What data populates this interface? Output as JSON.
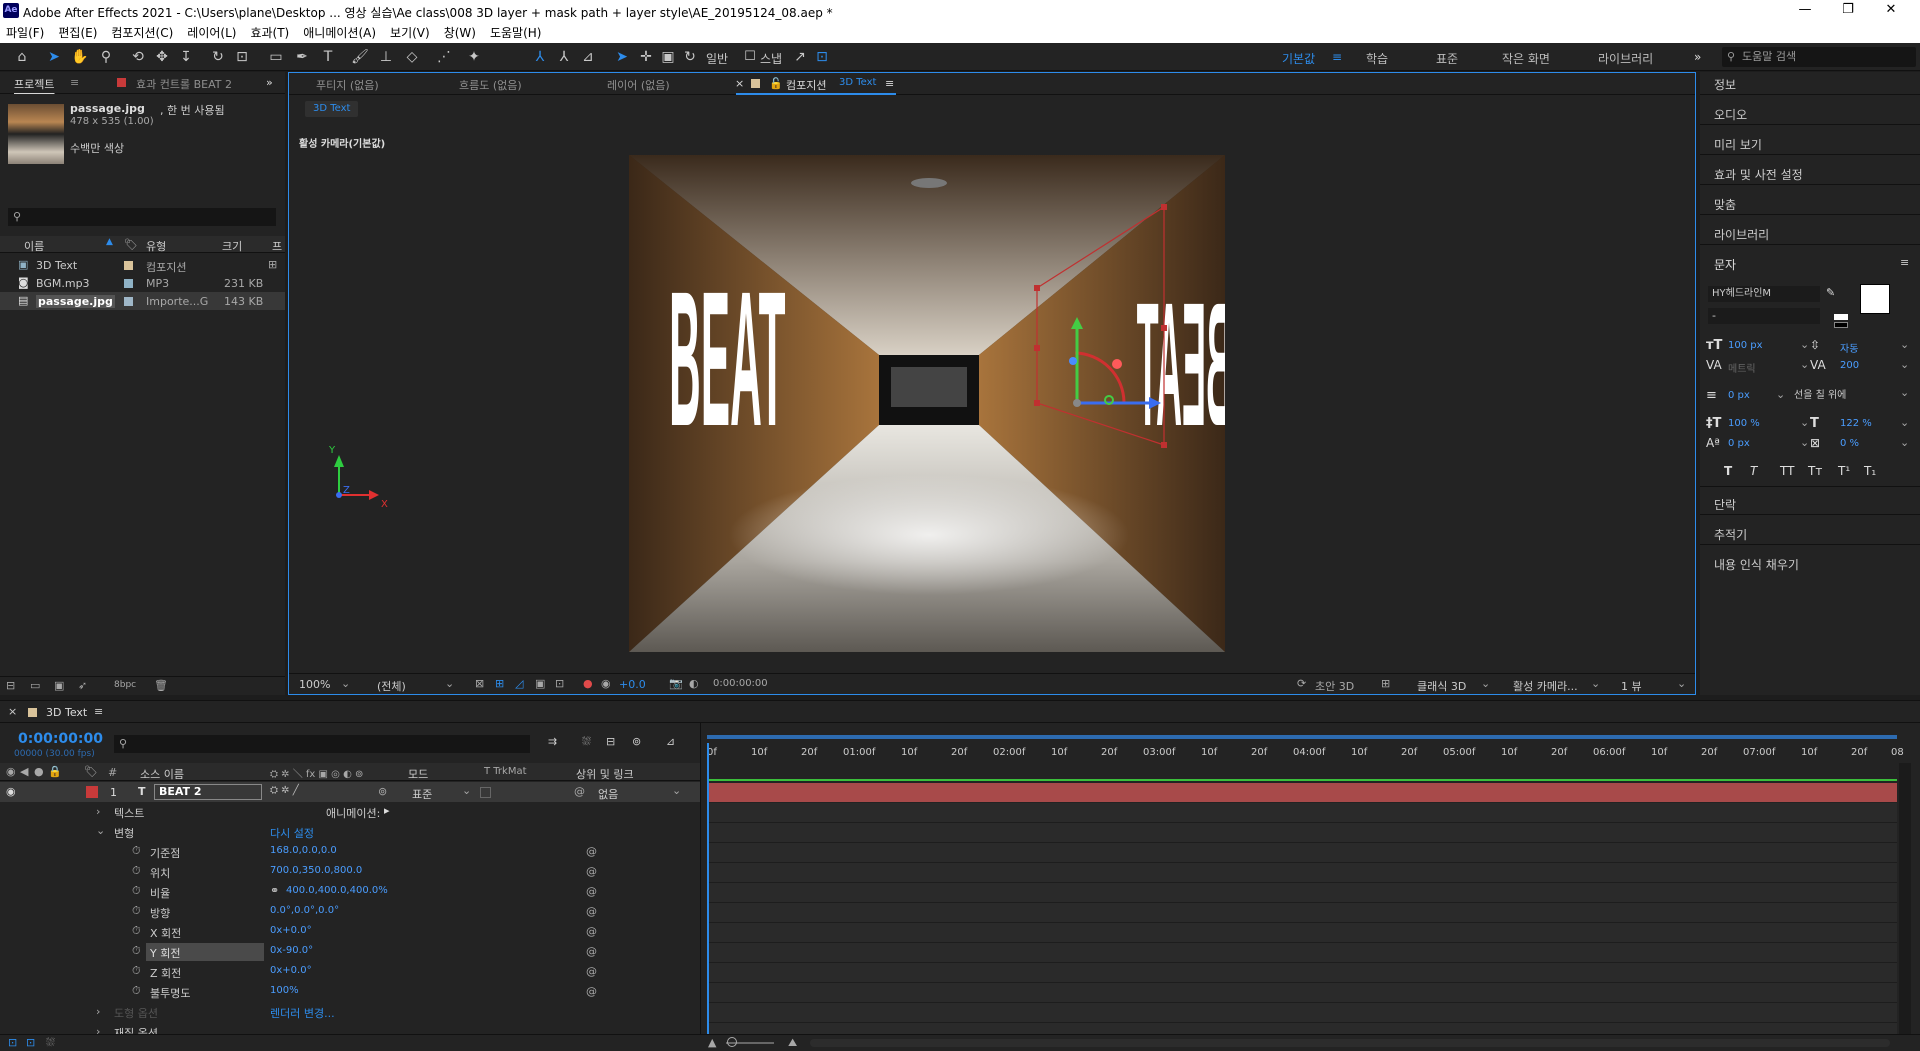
{
  "window": {
    "app_icon": "Ae",
    "title": "Adobe After Effects 2021 - C:\\Users\\plane\\Desktop ... 영상 실습\\Ae class\\008 3D layer + mask path + layer style\\AE_20195124_08.aep *",
    "minimize": "—",
    "maximize": "❐",
    "close": "✕"
  },
  "menu": [
    "파일(F)",
    "편집(E)",
    "컴포지션(C)",
    "레이어(L)",
    "효과(T)",
    "애니메이션(A)",
    "보기(V)",
    "창(W)",
    "도움말(H)"
  ],
  "toolbar": {
    "snap_label": "스냅",
    "align_label": "일반",
    "workspaces": [
      "기본값",
      "학습",
      "표준",
      "작은 화면",
      "라이브러리"
    ],
    "active_workspace": "기본값",
    "search_placeholder": "도움말 검색",
    "more": "»"
  },
  "project": {
    "tab_project": "프로젝트",
    "tab_effects": "효과 컨트롤 BEAT 2",
    "item_name": "passage.jpg",
    "item_usage": ", 한 번 사용됨",
    "item_dims": "478 x 535 (1.00)",
    "item_color": "수백만 색상",
    "search_placeholder": "",
    "columns": [
      "이름",
      "유형",
      "크기",
      "프"
    ],
    "items": [
      {
        "name": "3D Text",
        "type": "컴포지션",
        "size": "",
        "color": "#d9c39a"
      },
      {
        "name": "BGM.mp3",
        "type": "MP3",
        "size": "231 KB",
        "color": "#8fb2c6"
      },
      {
        "name": "passage.jpg",
        "type": "Importe...G",
        "size": "143 KB",
        "color": "#9fb7c8"
      }
    ],
    "bpc": "8bpc"
  },
  "viewer": {
    "tabs": [
      "푸티지 (없음)",
      "흐름도 (없음)",
      "레이어 (없음)",
      "컴포지션"
    ],
    "active_comp": "3D Text",
    "breadcrumb": "3D Text",
    "camera_label": "활성 카메라(기본값)",
    "scene_text_left": "BEAT",
    "scene_text_right": "BEAT",
    "zoom": "100%",
    "resolution": "(전체)",
    "exposure": "+0.0",
    "timecode": "0:00:00:00",
    "draft": "초안 3D",
    "renderer": "클래식 3D",
    "camera": "활성 카메라...",
    "views": "1 뷰",
    "axis_x": "X",
    "axis_y": "Y",
    "axis_z": "Z"
  },
  "right_panel": {
    "sections": [
      "정보",
      "오디오",
      "미리 보기",
      "효과 및 사전 설정",
      "맞춤",
      "라이브러리"
    ],
    "char_title": "문자",
    "font": "HY헤드라인M",
    "font_style": "-",
    "size": "100 px",
    "leading": "자동",
    "tracking_label": "메트릭",
    "tracking": "200",
    "stroke": "0 px",
    "stroke_mode": "선을 칠 위에",
    "vscale": "100 %",
    "hscale": "122 %",
    "baseline": "0 px",
    "tsume": "0 %",
    "style_buttons": [
      "T",
      "T",
      "TT",
      "Tт",
      "T¹",
      "T₁"
    ],
    "after": [
      "단락",
      "추적기",
      "내용 인식 채우기"
    ]
  },
  "timeline": {
    "tab": "3D Text",
    "timecode": "0:00:00:00",
    "fps": "00000 (30.00 fps)",
    "columns": {
      "num": "#",
      "source": "소스 이름",
      "mode": "모드",
      "trkmat": "T  TrkMat",
      "parent": "상위 및 링크"
    },
    "layer": {
      "num": "1",
      "type": "T",
      "name": "BEAT 2",
      "mode": "표준",
      "parent": "없음",
      "color": "#c83a3a"
    },
    "text_group": "텍스트",
    "animate": "애니메이션:",
    "transform_group": "변형",
    "reset": "다시 설정",
    "props": [
      {
        "name": "기준점",
        "value": "168.0,0.0,0.0"
      },
      {
        "name": "위치",
        "value": "700.0,350.0,800.0"
      },
      {
        "name": "비율",
        "value": "400.0,400.0,400.0%"
      },
      {
        "name": "방향",
        "value": "0.0°,0.0°,0.0°"
      },
      {
        "name": "X 회전",
        "value": "0x+0.0°"
      },
      {
        "name": "Y 회전",
        "value": "0x-90.0°"
      },
      {
        "name": "Z 회전",
        "value": "0x+0.0°"
      },
      {
        "name": "불투명도",
        "value": "100%"
      }
    ],
    "geometry_group": "도형 옵션",
    "geometry_value": "렌더러 변경...",
    "material_group": "재질 옵션",
    "ruler": [
      "0f",
      "10f",
      "20f",
      "01:00f",
      "10f",
      "20f",
      "02:00f",
      "10f",
      "20f",
      "03:00f",
      "10f",
      "20f",
      "04:00f",
      "10f",
      "20f",
      "05:00f",
      "10f",
      "20f",
      "06:00f",
      "10f",
      "20f",
      "07:00f",
      "10f",
      "20f",
      "08"
    ]
  }
}
